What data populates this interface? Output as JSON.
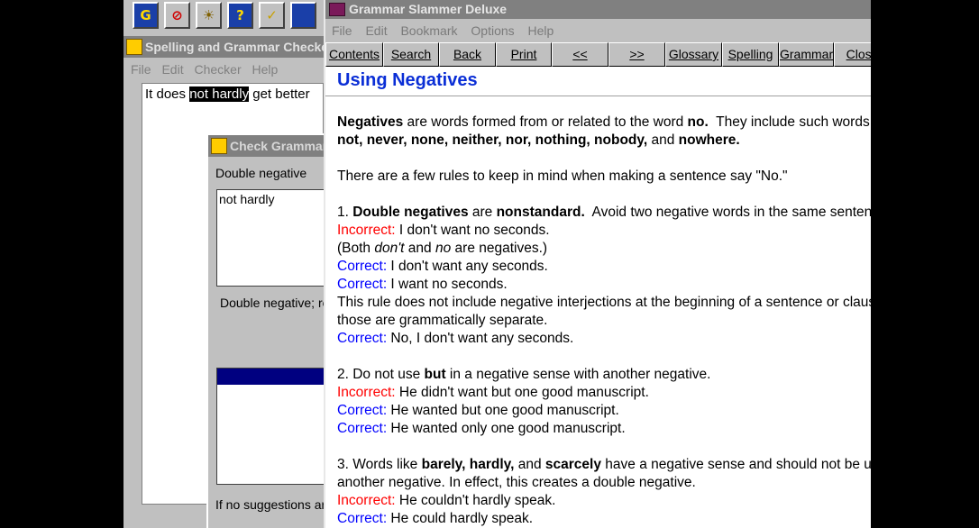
{
  "checker_window": {
    "title": "Spelling and Grammar Checker",
    "menu": [
      "File",
      "Edit",
      "Checker",
      "Help"
    ],
    "doc_text_before": "It does ",
    "doc_text_highlight": "not hardly",
    "doc_text_after": " get better",
    "dialog": {
      "title": "Check Grammar",
      "rule_label": "Double negative",
      "found_text": "not hardly",
      "explanation": "Double negative; rewrite",
      "footer": "If no suggestions are"
    }
  },
  "help_window": {
    "title": "Grammar Slammer Deluxe",
    "menu": [
      "File",
      "Edit",
      "Bookmark",
      "Options",
      "Help"
    ],
    "nav_buttons": [
      "Contents",
      "Search",
      "Back",
      "Print",
      "<<",
      ">>",
      "Glossary",
      "Spelling",
      "Grammar",
      "Close"
    ],
    "topic_title": "Using Negatives",
    "intro_1a": "Negatives",
    "intro_1b": " are words formed from or related to the word ",
    "intro_1c": "no.",
    "intro_1d": "  They include such words as",
    "intro_2a": "not, never, none, neither, nor, nothing, nobody,",
    "intro_2b": " and ",
    "intro_2c": "nowhere.",
    "rules_intro": "There are a few rules to keep in mind when making a sentence say \"No.\"",
    "r1_num": "1. ",
    "r1_bold1": "Double negatives",
    "r1_mid": " are ",
    "r1_bold2": "nonstandard.",
    "r1_tail": "  Avoid two negative words in the same sentence.",
    "incorrect_label": "Incorrect:",
    "correct_label": "Correct:",
    "r1_inc": " I don't want no seconds.",
    "r1_paren_a": "(Both ",
    "r1_paren_dont": "don't",
    "r1_paren_and": " and ",
    "r1_paren_no": "no",
    "r1_paren_b": " are negatives.)",
    "r1_cor1": " I don't want any seconds.",
    "r1_cor2": " I want no seconds.",
    "r1_note1": "This rule does not include negative interjections at the beginning of a sentence or clause, since",
    "r1_note2": "those are grammatically separate.",
    "r1_cor3": " No, I don't want any seconds.",
    "r2_a": "2. Do not use ",
    "r2_bold": "but",
    "r2_b": " in a negative sense with another negative.",
    "r2_inc": " He didn't want but one good manuscript.",
    "r2_cor1": " He wanted but one good manuscript.",
    "r2_cor2": " He wanted only one good manuscript.",
    "r3_a": "3. Words like ",
    "r3_bold": "barely, hardly,",
    "r3_b": " and ",
    "r3_bold2": "scarcely",
    "r3_c": " have a negative sense and should not be used with",
    "r3_line2": "another negative.  In effect, this creates a double negative.",
    "r3_inc": " He couldn't hardly speak.",
    "r3_cor": " He could hardly speak."
  },
  "colors": {
    "title_blue": "#0a2ed6",
    "incorrect_red": "#ff0000",
    "correct_blue": "#0000ff"
  }
}
